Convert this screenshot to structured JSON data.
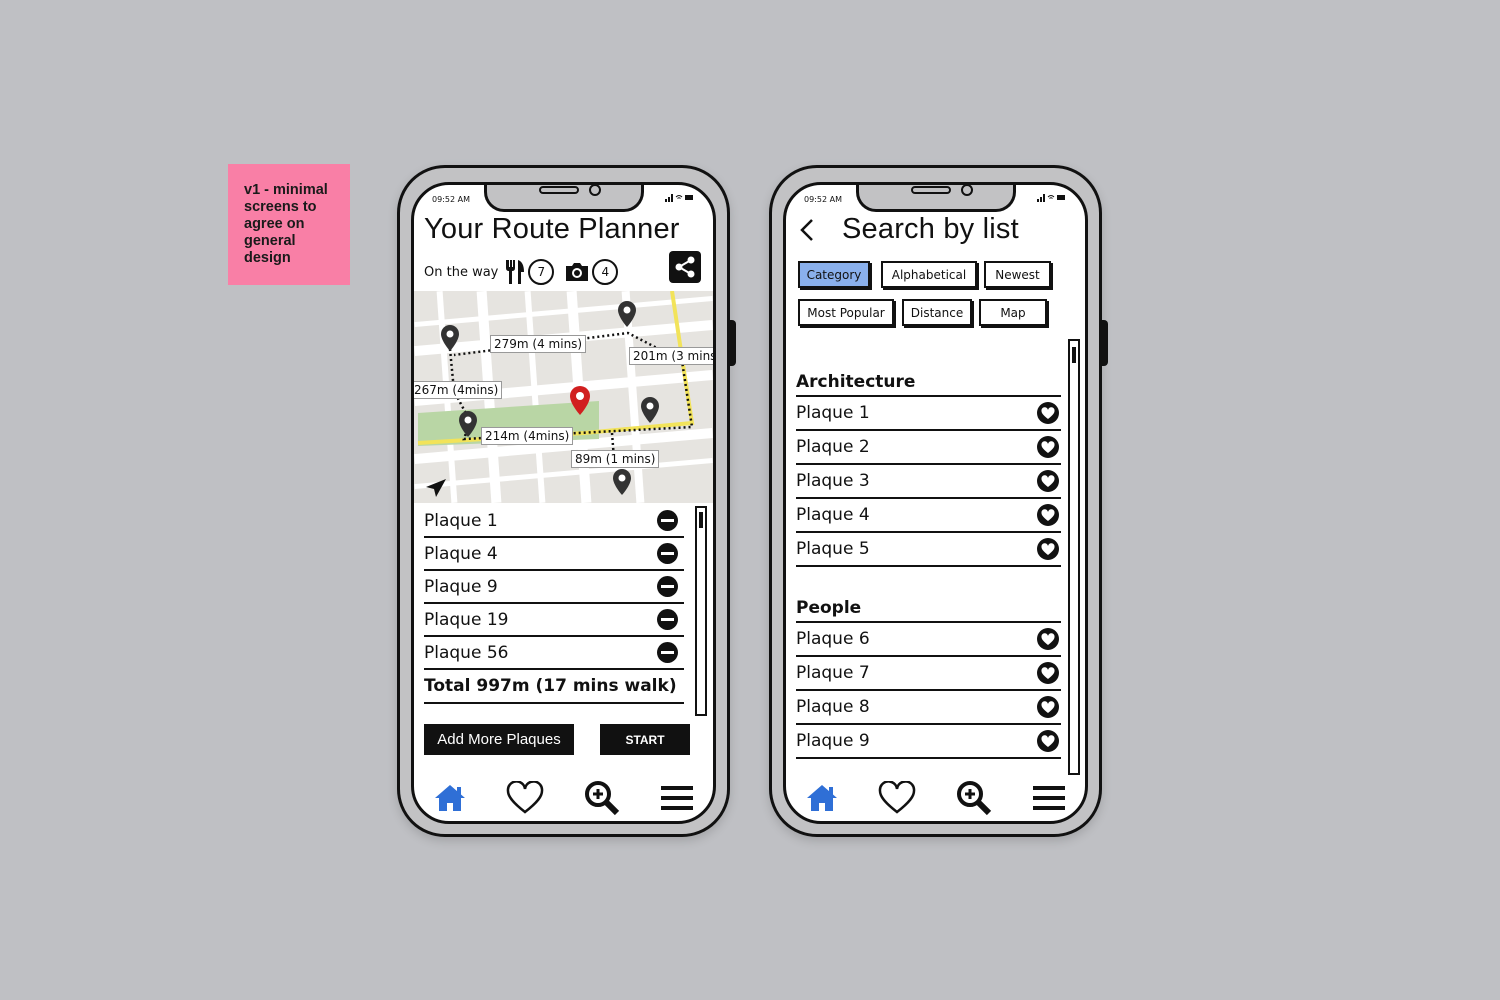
{
  "sticky_note": {
    "text": "v1 - minimal screens to agree on general design"
  },
  "phone1": {
    "status_time": "09:52 AM",
    "title": "Your Route Planner",
    "on_the_way_label": "On the way",
    "food_count": "7",
    "photo_count": "4",
    "map_labels": [
      "279m (4 mins)",
      "201m (3 mins)",
      "267m (4mins)",
      "214m (4mins)",
      "89m (1 mins)"
    ],
    "plaques": [
      "Plaque 1",
      "Plaque 4",
      "Plaque 9",
      "Plaque 19",
      "Plaque 56"
    ],
    "total": "Total 997m (17 mins walk)",
    "add_more_label": "Add More Plaques",
    "start_label": "START",
    "icons": {
      "food": "fork-knife-icon",
      "photo": "camera-icon",
      "share": "share-icon",
      "locate": "location-arrow-icon",
      "remove": "minus-circle-icon"
    }
  },
  "phone2": {
    "status_time": "09:52 AM",
    "title": "Search by list",
    "filters": [
      "Category",
      "Alphabetical",
      "Newest",
      "Most Popular",
      "Distance",
      "Map"
    ],
    "active_filter": "Category",
    "sections": [
      {
        "name": "Architecture",
        "items": [
          "Plaque 1",
          "Plaque 2",
          "Plaque 3",
          "Plaque 4",
          "Plaque 5"
        ]
      },
      {
        "name": "People",
        "items": [
          "Plaque 6",
          "Plaque 7",
          "Plaque 8",
          "Plaque 9"
        ]
      }
    ]
  },
  "nav": [
    "home",
    "favorites",
    "search",
    "menu"
  ],
  "colors": {
    "background": "#bfc0c4",
    "sticky": "#f97fa6",
    "accent_blue": "#2f6fd6",
    "active_filter": "#8ab0ec",
    "pin_red": "#d11f1f",
    "route_yellow": "#f2e35a",
    "park_green": "#b9d6a5"
  }
}
